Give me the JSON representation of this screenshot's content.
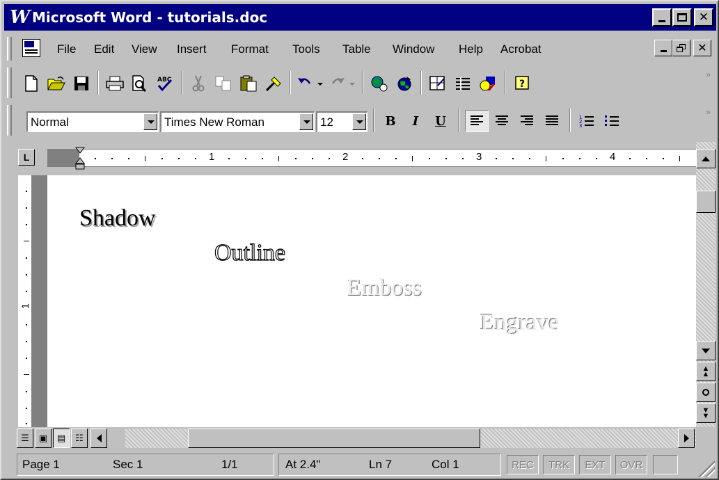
{
  "window": {
    "title": "Microsoft Word - tutorials.doc",
    "logo": "W"
  },
  "menubar": {
    "items": [
      "File",
      "Edit",
      "View",
      "Insert",
      "Format",
      "Tools",
      "Table",
      "Window",
      "Help",
      "Acrobat"
    ]
  },
  "formatting": {
    "style": "Normal",
    "font": "Times New Roman",
    "size": "12",
    "bold": "B",
    "italic": "I",
    "underline": "U"
  },
  "ruler": {
    "tab_selector": "L",
    "labels": [
      "1",
      "2",
      "3",
      "4"
    ]
  },
  "document": {
    "lines": [
      "Shadow",
      "Outline",
      "Emboss",
      "Engrave"
    ]
  },
  "status": {
    "page": "Page 1",
    "sec": "Sec 1",
    "page_of": "1/1",
    "at": "At 2.4\"",
    "ln": "Ln 7",
    "col": "Col 1",
    "rec": "REC",
    "trk": "TRK",
    "ext": "EXT",
    "ovr": "OVR"
  },
  "icons": {
    "toolbar1": [
      "new-document-icon",
      "open-icon",
      "save-icon",
      "print-icon",
      "print-preview-icon",
      "spelling-icon",
      "cut-icon",
      "copy-icon",
      "paste-icon",
      "format-painter-icon",
      "undo-icon",
      "redo-icon",
      "web-icon",
      "hyperlink-icon",
      "tables-borders-icon",
      "insert-table-icon",
      "drawing-icon",
      "office-assistant-icon"
    ],
    "toolbar2": [
      "align-left-icon",
      "center-icon",
      "align-right-icon",
      "justify-icon",
      "numbering-icon",
      "bullets-icon"
    ]
  },
  "colors": {
    "titlebar": "#000080",
    "face": "#c0c0c0"
  }
}
